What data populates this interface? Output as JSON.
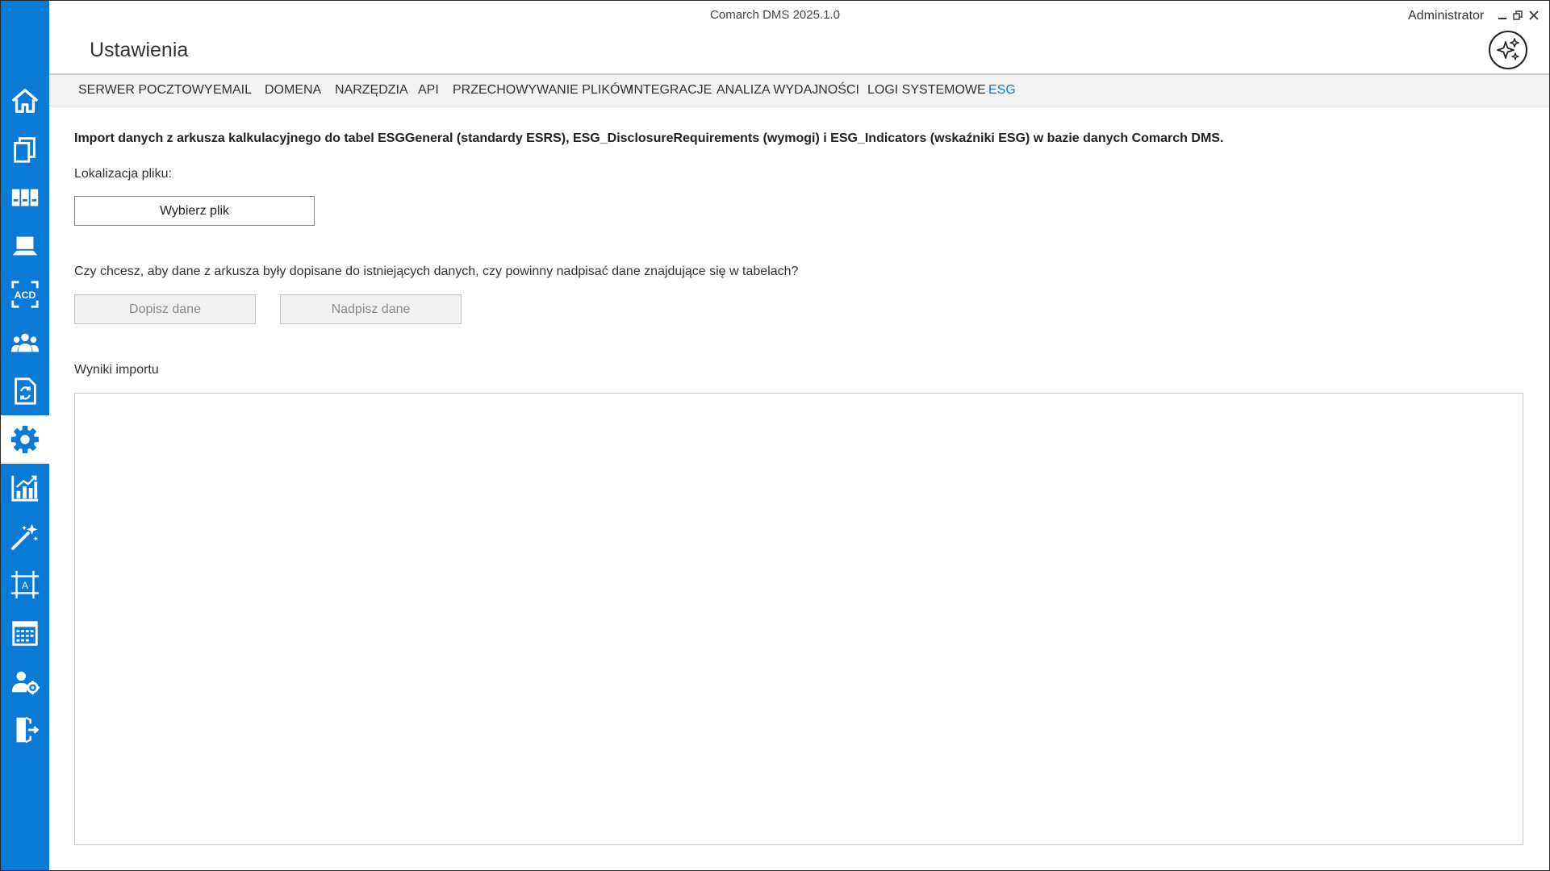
{
  "app": {
    "title": "Comarch DMS 2025.1.0",
    "user": "Administrator",
    "page_title": "Ustawienia"
  },
  "colors": {
    "accent": "#0a7ad7",
    "tab_active": "#0a7ad7",
    "sidebar_bg": "#0a7ad7"
  },
  "sidebar": {
    "items": [
      {
        "icon": "home-icon",
        "active": false
      },
      {
        "icon": "documents-icon",
        "active": false
      },
      {
        "icon": "binders-icon",
        "active": false
      },
      {
        "icon": "laptop-icon",
        "active": false
      },
      {
        "icon": "acd-ocr-icon",
        "active": false
      },
      {
        "icon": "users-icon",
        "active": false
      },
      {
        "icon": "document-exchange-icon",
        "active": false
      },
      {
        "icon": "gear-icon",
        "active": true
      },
      {
        "icon": "chart-icon",
        "active": false
      },
      {
        "icon": "magic-wand-icon",
        "active": false
      },
      {
        "icon": "text-frame-icon",
        "active": false
      },
      {
        "icon": "calendar-icon",
        "active": false
      },
      {
        "icon": "user-settings-icon",
        "active": false
      },
      {
        "icon": "logout-icon",
        "active": false
      }
    ]
  },
  "tabs": [
    {
      "label": "SERWER POCZTOWY",
      "active": false
    },
    {
      "label": "EMAIL",
      "active": false
    },
    {
      "label": "DOMENA",
      "active": false
    },
    {
      "label": "NARZĘDZIA",
      "active": false
    },
    {
      "label": "API",
      "active": false
    },
    {
      "label": "PRZECHOWYWANIE PLIKÓW",
      "active": false
    },
    {
      "label": "INTEGRACJE",
      "active": false
    },
    {
      "label": "ANALIZA WYDAJNOŚCI",
      "active": false
    },
    {
      "label": "LOGI SYSTEMOWE",
      "active": false
    },
    {
      "label": "ESG",
      "active": true
    }
  ],
  "esg": {
    "description": "Import danych z arkusza kalkulacyjnego do tabel ESGGeneral (standardy ESRS), ESG_DisclosureRequirements (wymogi) i ESG_Indicators (wskaźniki ESG) w bazie danych Comarch DMS.",
    "file_location_label": "Lokalizacja pliku:",
    "choose_file_button": "Wybierz plik",
    "question": "Czy chcesz, aby dane z arkusza były dopisane do istniejących danych, czy powinny nadpisać dane znajdujące się w tabelach?",
    "append_button": "Dopisz dane",
    "overwrite_button": "Nadpisz dane",
    "results_label": "Wyniki importu",
    "results_value": ""
  }
}
